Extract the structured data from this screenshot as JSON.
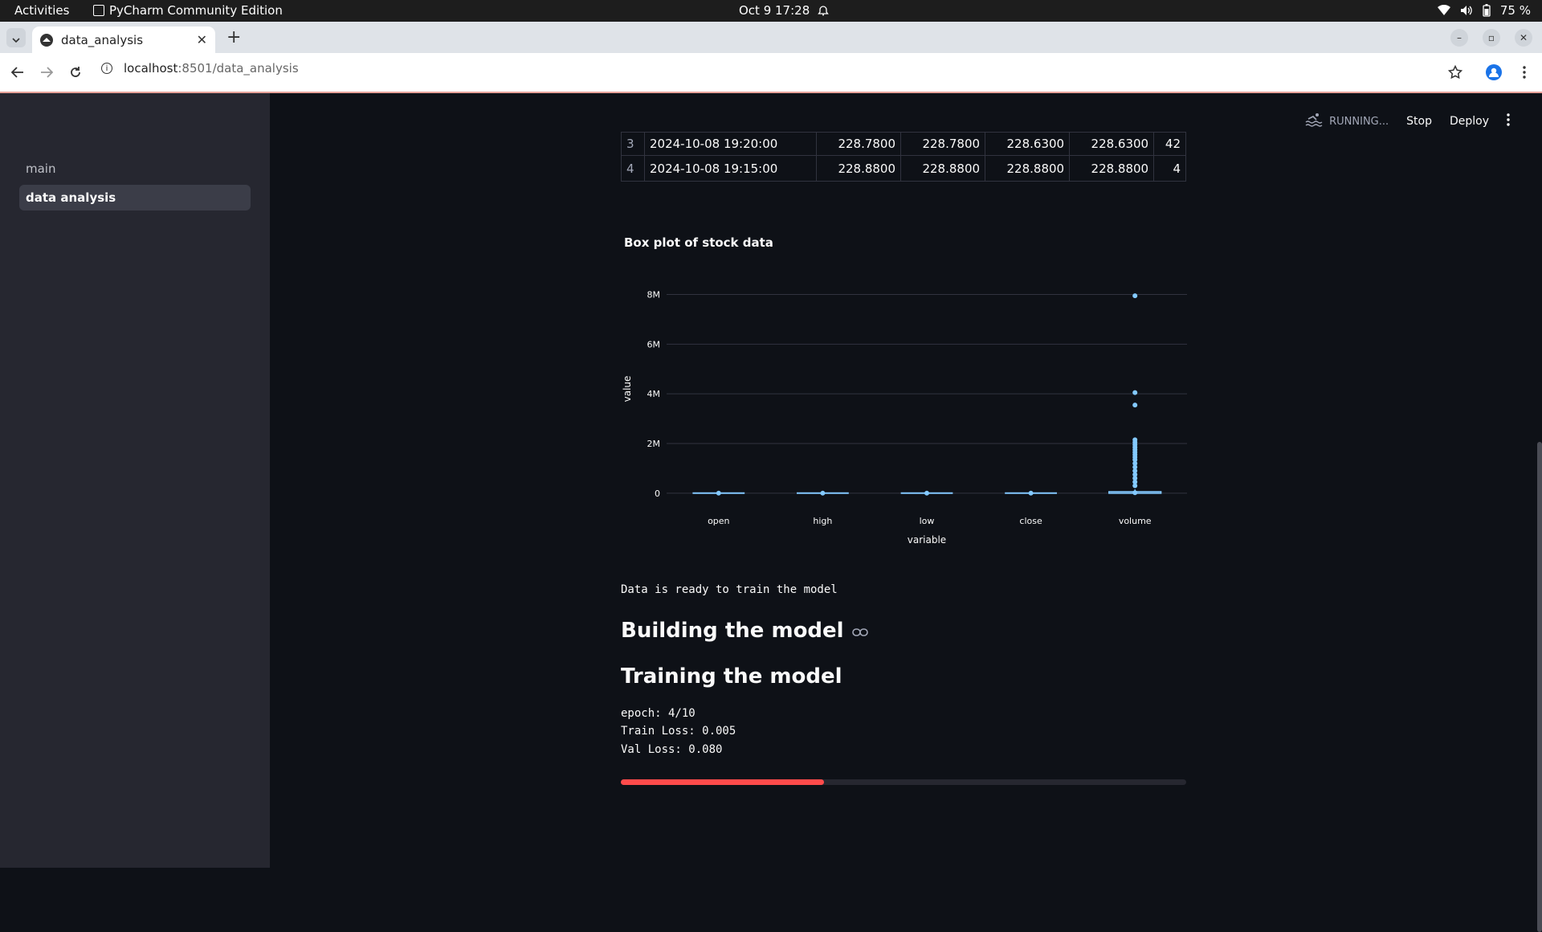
{
  "os_bar": {
    "activities": "Activities",
    "app_name": "PyCharm Community Edition",
    "datetime": "Oct 9  17:28",
    "battery": "75 %"
  },
  "browser": {
    "tab_title": "data_analysis",
    "url_host": "localhost",
    "url_path": ":8501/data_analysis"
  },
  "sidebar": {
    "items": [
      {
        "label": "main",
        "active": false
      },
      {
        "label": "data analysis",
        "active": true
      }
    ]
  },
  "status": {
    "running": "RUNNING...",
    "stop": "Stop",
    "deploy": "Deploy"
  },
  "table": {
    "rows": [
      {
        "idx": "3",
        "time": "2024-10-08 19:20:00",
        "c1": "228.7800",
        "c2": "228.7800",
        "c3": "228.6300",
        "c4": "228.6300",
        "c5": "42"
      },
      {
        "idx": "4",
        "time": "2024-10-08 19:15:00",
        "c1": "228.8800",
        "c2": "228.8800",
        "c3": "228.8800",
        "c4": "228.8800",
        "c5": "4"
      }
    ]
  },
  "chart_title": "Box plot of stock data",
  "chart_data": {
    "type": "box",
    "categories": [
      "open",
      "high",
      "low",
      "close",
      "volume"
    ],
    "xlabel": "variable",
    "ylabel": "value",
    "yticks": [
      "0",
      "2M",
      "4M",
      "6M",
      "8M"
    ],
    "ylim": [
      -200000,
      8600000
    ],
    "grid": true,
    "series_color": "#83c9ff",
    "boxes": [
      {
        "category": "open",
        "median": 229,
        "outliers": []
      },
      {
        "category": "high",
        "median": 229,
        "outliers": []
      },
      {
        "category": "low",
        "median": 229,
        "outliers": []
      },
      {
        "category": "close",
        "median": 229,
        "outliers": []
      },
      {
        "category": "volume",
        "median": 20000,
        "q3": 60000,
        "upper_fence": 150000,
        "outliers": [
          7950000,
          4050000,
          3550000,
          2150000,
          2050000,
          1950000,
          1850000,
          1750000,
          1650000,
          1550000,
          1450000,
          1350000,
          1200000,
          1050000,
          900000,
          750000,
          600000,
          450000,
          300000
        ]
      }
    ]
  },
  "messages": {
    "data_ready": "Data  is ready to train the model",
    "heading_build": "Building the model",
    "heading_train": "Training the model",
    "epoch": "epoch: 4/10",
    "train_loss": "Train Loss: 0.005",
    "val_loss": "Val Loss: 0.080"
  },
  "progress": {
    "value": 0.36,
    "color": "#ff4b4b"
  }
}
